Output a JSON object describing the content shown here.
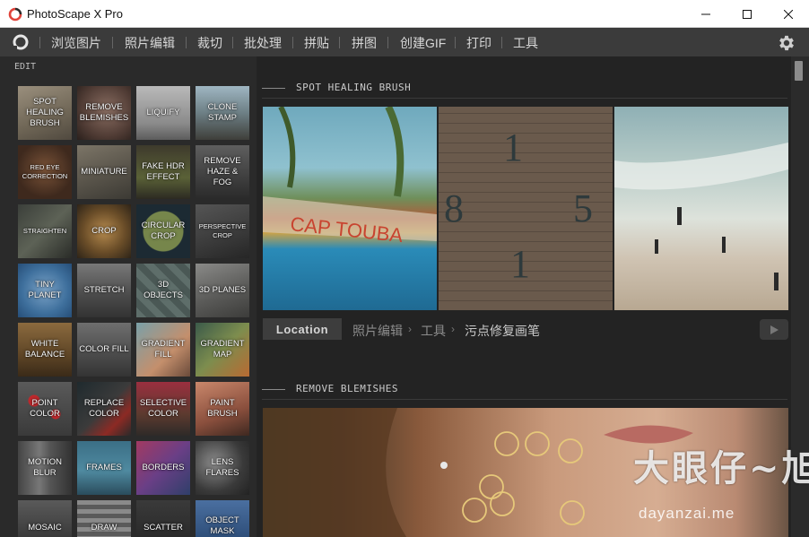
{
  "window": {
    "title": "PhotoScape X Pro"
  },
  "menu": {
    "items": [
      "浏览图片",
      "照片编辑",
      "裁切",
      "批处理",
      "拼贴",
      "拼图",
      "创建GIF",
      "打印",
      "工具"
    ]
  },
  "left": {
    "section_label": "EDIT",
    "tiles": [
      "SPOT HEALING BRUSH",
      "REMOVE BLEMISHES",
      "LIQUIFY",
      "CLONE STAMP",
      "RED EYE CORRECTION",
      "MINIATURE",
      "FAKE HDR EFFECT",
      "REMOVE HAZE & FOG",
      "STRAIGHTEN",
      "CROP",
      "CIRCULAR CROP",
      "PERSPECTIVE CROP",
      "TINY PLANET",
      "STRETCH",
      "3D OBJECTS",
      "3D PLANES",
      "WHITE BALANCE",
      "COLOR FILL",
      "GRADIENT FILL",
      "GRADIENT MAP",
      "POINT COLOR",
      "REPLACE COLOR",
      "SELECTIVE COLOR",
      "PAINT BRUSH",
      "MOTION BLUR",
      "FRAMES",
      "BORDERS",
      "LENS FLARES",
      "MOSAIC",
      "DRAW",
      "SCATTER",
      "OBJECT MASK"
    ]
  },
  "main": {
    "sections": [
      {
        "title": "SPOT HEALING BRUSH"
      },
      {
        "title": "REMOVE BLEMISHES"
      }
    ],
    "photo_text": {
      "sign": "CAP TOUBA",
      "digits": [
        "8",
        "1",
        "5"
      ]
    },
    "location_button": "Location",
    "breadcrumb": [
      "照片编辑",
      "工具",
      "污点修复画笔"
    ]
  },
  "watermark": {
    "text": "大眼仔~旭",
    "url": "dayanzai.me"
  },
  "colors": {
    "background": "#232323",
    "menubar": "#3b3b3b",
    "panel": "#2a2a2a"
  }
}
